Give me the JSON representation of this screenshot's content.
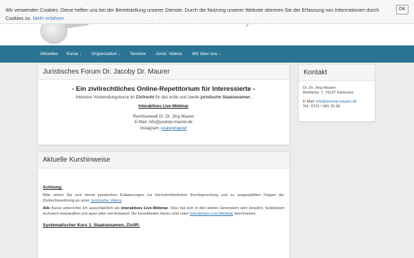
{
  "header": {
    "site_title": "Juristisches Forum Dr. Jacoby Dr. Maurer"
  },
  "nav": {
    "items": [
      {
        "label": "Aktuelles",
        "dropdown": false
      },
      {
        "label": "Kurse",
        "dropdown": true
      },
      {
        "label": "Organisation",
        "dropdown": true
      },
      {
        "label": "Termine",
        "dropdown": false
      },
      {
        "label": "Jurist. Videos",
        "dropdown": false
      },
      {
        "label": "Wir über uns",
        "dropdown": true
      }
    ],
    "arrow": "↓"
  },
  "cookie": {
    "text": "Wir verwenden Cookies. Diese helfen uns bei der Bereitstellung unserer Dienste. Durch die Nutzung unserer Website stimmen Sie der Erfassung von Informationen durch Cookies zu.",
    "link": "Mehr erfahren",
    "ok": "OK"
  },
  "main_panel": {
    "title": "Juristisches Forum Dr. Jacoby Dr. Maurer",
    "headline": "- Ein zivilrechtliches Online-Repetitorium für Interessierte -",
    "sub_a": "Intensive Vorbereitungskurse im ",
    "sub_b": "Zivilrecht",
    "sub_c": " für das erste und zweite ",
    "sub_d": "juristische Staatsexamen",
    "sub_e": ".",
    "webinar": "Interaktives Live-Webinar",
    "lawyer": "Rechtsanwalt Dr. Dr. Jörg Maurer",
    "email": "E-Mail: info@jurarep-maurer.de",
    "instagram_label": "Instagram: ",
    "instagram_handle": "jurarepmaurer"
  },
  "contact": {
    "title": "Kontakt",
    "name": "Dr. Dr. Jörg Maurer",
    "address": "Bürklinstr. 7, 76137 Karlsruhe",
    "email_label": "E-Mail: ",
    "email": "info@jurarep-maurer.de",
    "tel": "Tel.: 0721 / 981 25 06"
  },
  "news": {
    "title": "Aktuelle Kurshinweise",
    "achtung": "Achtung:",
    "p1": "Bitte sehen Sie sich meine juristischen Erläuterungen zur höchstrichterlichen Rechtsprechung und zu ausgewählten Fragen der Zivilrechtsordnung an unter ",
    "p1_link": "Juristische Videos",
    "p1_end": ".",
    "p2_a": "Alle",
    "p2_b": " Kurse unterrichte ich ausschließlich als ",
    "p2_c": "interaktives Live-Webinar",
    "p2_d": ". Dies hat sich in den letzten Semestern sehr bewährt, funktioniert technisch einwandfrei und spart allen viel Aufwand. Die Einzelheiten hierzu sind unter ",
    "p2_link": "Interaktives Live-Webinar",
    "p2_e": " beschrieben.",
    "kurs": "Systematischer Kurs 1. Staatsexamen, ZivilR:"
  }
}
